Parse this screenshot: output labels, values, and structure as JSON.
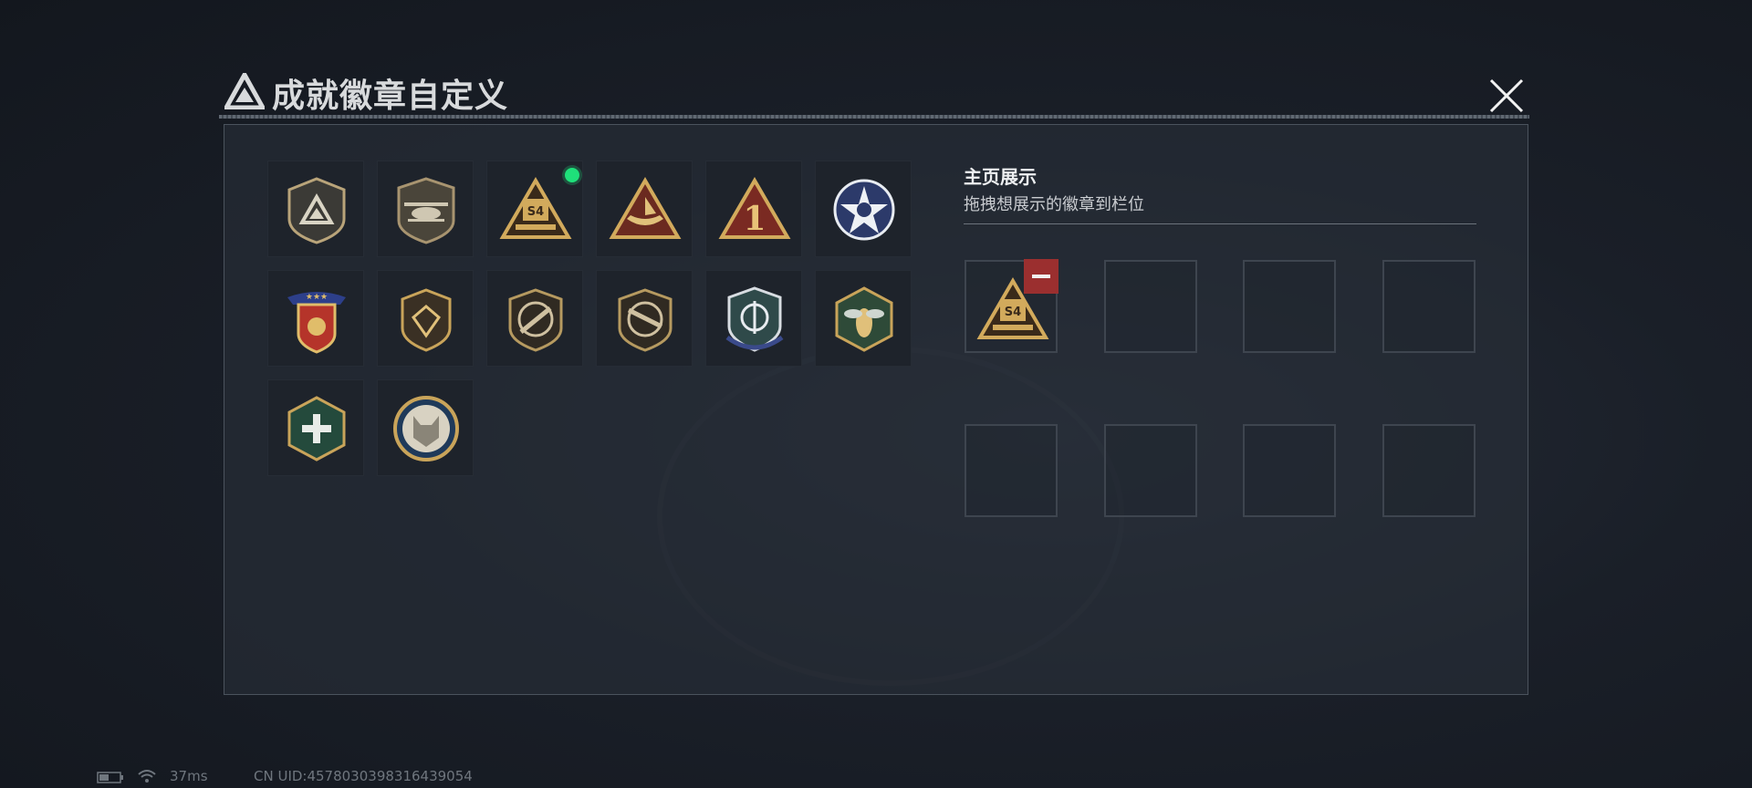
{
  "dialog": {
    "title": "成就徽章自定义"
  },
  "badges": [
    {
      "name": "shield-delta-badge",
      "new": false
    },
    {
      "name": "helicopter-badge",
      "new": false
    },
    {
      "name": "s4-triangle-badge",
      "new": true
    },
    {
      "name": "boat-triangle-badge",
      "new": false
    },
    {
      "name": "number-one-triangle-badge",
      "new": false
    },
    {
      "name": "star-wings-badge",
      "new": false
    },
    {
      "name": "three-star-shield-badge",
      "new": false
    },
    {
      "name": "gem-shield-badge",
      "new": false
    },
    {
      "name": "rifle-shield-badge-1",
      "new": false
    },
    {
      "name": "rifle-shield-badge-2",
      "new": false
    },
    {
      "name": "crosshair-wings-badge",
      "new": false
    },
    {
      "name": "wasp-hexagon-badge",
      "new": false
    },
    {
      "name": "medic-hexagon-badge",
      "new": false
    },
    {
      "name": "wolf-circle-badge",
      "new": false
    }
  ],
  "showcase": {
    "title": "主页展示",
    "subtitle": "拖拽想展示的徽章到栏位",
    "slots": [
      "s4-triangle-badge",
      "",
      "",
      "",
      "",
      "",
      "",
      ""
    ]
  },
  "status": {
    "ping": "37ms",
    "uid": "CN UID:4578030398316439054"
  },
  "colors": {
    "gold": "#c9a45a",
    "dark_red": "#7a2a22",
    "remove_red": "#9b2f2f",
    "new_dot_green": "#1fe07a"
  }
}
